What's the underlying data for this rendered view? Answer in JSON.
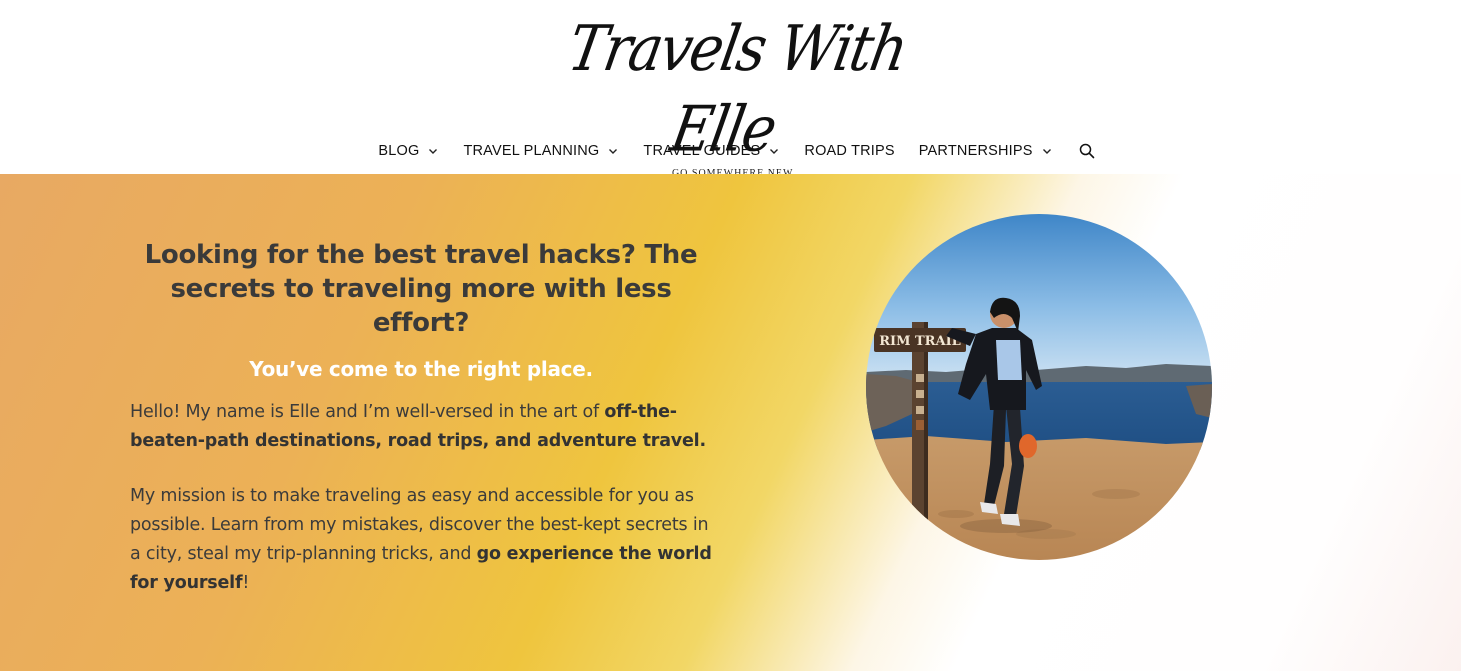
{
  "header": {
    "logo_text": "Travels With Elle",
    "tagline": "GO SOMEWHERE NEW."
  },
  "nav": {
    "items": [
      {
        "label": "BLOG",
        "has_dropdown": true
      },
      {
        "label": "TRAVEL PLANNING",
        "has_dropdown": true
      },
      {
        "label": "TRAVEL GUIDES",
        "has_dropdown": true
      },
      {
        "label": "ROAD TRIPS",
        "has_dropdown": false
      },
      {
        "label": "PARTNERSHIPS",
        "has_dropdown": true
      }
    ],
    "search_icon": "search-icon"
  },
  "hero": {
    "heading": "Looking for the best travel hacks? The secrets to traveling more with less effort?",
    "subheading": "You’ve come to the right place.",
    "para1": {
      "text": "Hello! My name is Elle and I’m well-versed in the art of ",
      "bold": "off-the-beaten-path destinations, road trips, and adventure travel."
    },
    "para2": {
      "text": "My mission is to make traveling as easy and accessible for you as possible. Learn from my mistakes, discover the best-kept secrets in a city, steal my trip-planning tricks, and ",
      "bold": "go experience the world for yourself",
      "end": "!"
    },
    "photo": {
      "sign_text": "RIM TRAIL"
    }
  },
  "colors": {
    "gradient_orange": "#e8a963",
    "gradient_yellow": "#efc53e",
    "heading": "#3a3a3a",
    "subheading": "#ffffff",
    "body_text": "#3b3b3b"
  }
}
